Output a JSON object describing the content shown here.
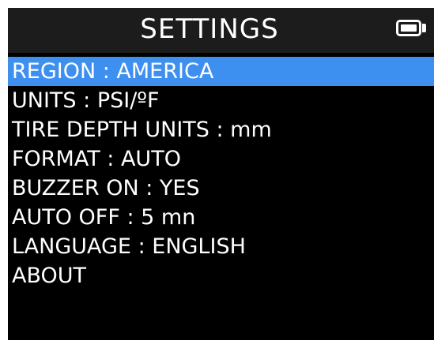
{
  "header": {
    "title": "SETTINGS",
    "battery_icon": "battery-full-icon"
  },
  "menu": {
    "selected_index": 0,
    "items": [
      {
        "label": "REGION : AMERICA"
      },
      {
        "label": "UNITS : PSI/ºF"
      },
      {
        "label": "TIRE DEPTH UNITS : mm"
      },
      {
        "label": "FORMAT : AUTO"
      },
      {
        "label": "BUZZER ON : YES"
      },
      {
        "label": "AUTO OFF : 5 mn"
      },
      {
        "label": "LANGUAGE : ENGLISH"
      },
      {
        "label": "ABOUT"
      }
    ]
  },
  "colors": {
    "background": "#000000",
    "header_background": "#1c1c1c",
    "highlight": "#3d8ff0",
    "text": "#ffffff"
  }
}
